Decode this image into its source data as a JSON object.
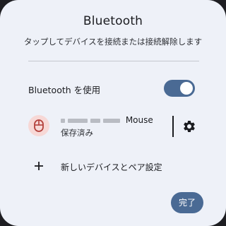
{
  "dialog": {
    "title": "Bluetooth",
    "subtitle": "タップしてデバイスを接続または接続解除します"
  },
  "bluetooth_toggle": {
    "label": "Bluetooth を使用",
    "state": "on"
  },
  "device": {
    "icon": "mouse-icon",
    "name_visible": "Mouse",
    "status": "保存済み"
  },
  "add_device": {
    "icon": "plus-icon",
    "label": "新しいデバイスとペア設定"
  },
  "done_button": {
    "label": "完了"
  },
  "colors": {
    "dialog_bg": "#eef1f8",
    "accent": "#4a6a94",
    "device_icon_bg": "#f7d8d6",
    "device_icon_fg": "#b3403b"
  }
}
